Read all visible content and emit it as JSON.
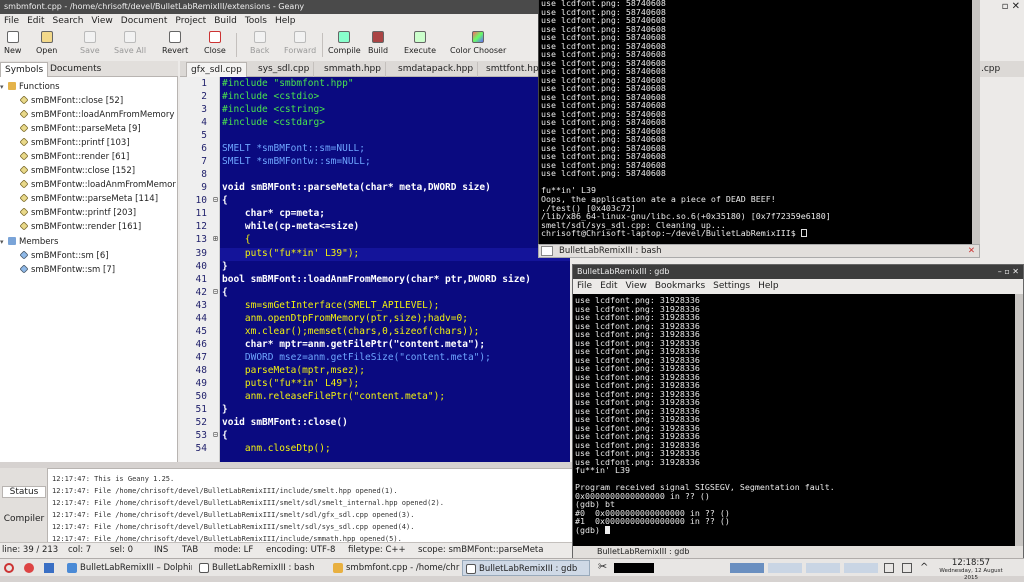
{
  "geany": {
    "title": "smbmfont.cpp - /home/chrisoft/devel/BulletLabRemixIII/extensions - Geany",
    "menu": [
      "File",
      "Edit",
      "Search",
      "View",
      "Document",
      "Project",
      "Build",
      "Tools",
      "Help"
    ],
    "toolbar": {
      "new": "New",
      "open": "Open",
      "save": "Save",
      "save_all": "Save All",
      "revert": "Revert",
      "close": "Close",
      "back": "Back",
      "forward": "Forward",
      "compile": "Compile",
      "build": "Build",
      "execute": "Execute",
      "color_chooser": "Color Chooser"
    },
    "sidebar": {
      "tabs": [
        "Symbols",
        "Documents"
      ],
      "functions_label": "Functions",
      "functions": [
        "smBMFont::close [52]",
        "smBMFont::loadAnmFromMemory",
        "smBMFont::parseMeta [9]",
        "smBMFont::printf [103]",
        "smBMFont::render [61]",
        "smBMFontw::close [152]",
        "smBMFontw::loadAnmFromMemor",
        "smBMFontw::parseMeta [114]",
        "smBMFontw::printf [203]",
        "smBMFontw::render [161]"
      ],
      "members_label": "Members",
      "members": [
        "smBMFont::sm [6]",
        "smBMFontw::sm [7]"
      ]
    },
    "editor": {
      "tabs": [
        "gfx_sdl.cpp",
        "sys_sdl.cpp",
        "smmath.hpp",
        "smdatapack.hpp",
        "smttfont.hpp"
      ],
      "tabs_right": ".cpp",
      "lines": [
        {
          "n": "1",
          "t": "#include \"smbmfont.hpp\""
        },
        {
          "n": "2",
          "t": "#include <cstdio>"
        },
        {
          "n": "3",
          "t": "#include <cstring>"
        },
        {
          "n": "4",
          "t": "#include <cstdarg>"
        },
        {
          "n": "5",
          "t": ""
        },
        {
          "n": "6",
          "t": "SMELT *smBMFont::sm=NULL;"
        },
        {
          "n": "7",
          "t": "SMELT *smBMFontw::sm=NULL;"
        },
        {
          "n": "8",
          "t": ""
        },
        {
          "n": "9",
          "t": "void smBMFont::parseMeta(char* meta,DWORD size)"
        },
        {
          "n": "10",
          "t": "{"
        },
        {
          "n": "11",
          "t": "    char* cp=meta;"
        },
        {
          "n": "12",
          "t": "    while(cp-meta<=size)"
        },
        {
          "n": "13",
          "t": "    {"
        },
        {
          "n": "39",
          "t": "    puts(\"fu**in' L39\");"
        },
        {
          "n": "40",
          "t": "}"
        },
        {
          "n": "41",
          "t": "bool smBMFont::loadAnmFromMemory(char* ptr,DWORD size)"
        },
        {
          "n": "42",
          "t": "{"
        },
        {
          "n": "43",
          "t": "    sm=smGetInterface(SMELT_APILEVEL);"
        },
        {
          "n": "44",
          "t": "    anm.openDtpFromMemory(ptr,size);hadv=0;"
        },
        {
          "n": "45",
          "t": "    xm.clear();memset(chars,0,sizeof(chars));"
        },
        {
          "n": "46",
          "t": "    char* mptr=anm.getFilePtr(\"content.meta\");"
        },
        {
          "n": "47",
          "t": "    DWORD msez=anm.getFileSize(\"content.meta\");"
        },
        {
          "n": "48",
          "t": "    parseMeta(mptr,msez);"
        },
        {
          "n": "49",
          "t": "    puts(\"fu**in' L49\");"
        },
        {
          "n": "50",
          "t": "    anm.releaseFilePtr(\"content.meta\");"
        },
        {
          "n": "51",
          "t": "}"
        },
        {
          "n": "52",
          "t": "void smBMFont::close()"
        },
        {
          "n": "53",
          "t": "{"
        },
        {
          "n": "54",
          "t": "    anm.closeDtp();"
        }
      ]
    },
    "messages": {
      "tabs": [
        "Status",
        "Compiler"
      ],
      "lines": [
        "12:17:47: This is Geany 1.25.",
        "12:17:47: File /home/chrisoft/devel/BulletLabRemixIII/include/smelt.hpp opened(1).",
        "12:17:47: File /home/chrisoft/devel/BulletLabRemixIII/smelt/sdl/smelt_internal.hpp opened(2).",
        "12:17:47: File /home/chrisoft/devel/BulletLabRemixIII/smelt/sdl/gfx_sdl.cpp opened(3).",
        "12:17:47: File /home/chrisoft/devel/BulletLabRemixIII/smelt/sdl/sys_sdl.cpp opened(4).",
        "12:17:47: File /home/chrisoft/devel/BulletLabRemixIII/include/smmath.hpp opened(5)."
      ]
    },
    "status": {
      "line": "line: 39 / 213",
      "col": "col: 7",
      "sel": "sel: 0",
      "ins": "INS",
      "tab": "TAB",
      "mode": "mode: LF",
      "encoding": "encoding: UTF-8",
      "filetype": "filetype: C++",
      "scope": "scope: smBMFont::parseMeta"
    }
  },
  "terminal1": {
    "lines": [
      "use lcdfont.png: 58740608",
      "use lcdfont.png: 58740608",
      "use lcdfont.png: 58740608",
      "use lcdfont.png: 58740608",
      "use lcdfont.png: 58740608",
      "use lcdfont.png: 58740608",
      "use lcdfont.png: 58740608",
      "use lcdfont.png: 58740608",
      "use lcdfont.png: 58740608",
      "use lcdfont.png: 58740608",
      "use lcdfont.png: 58740608",
      "use lcdfont.png: 58740608",
      "use lcdfont.png: 58740608",
      "use lcdfont.png: 58740608",
      "use lcdfont.png: 58740608",
      "use lcdfont.png: 58740608",
      "use lcdfont.png: 58740608",
      "use lcdfont.png: 58740608",
      "use lcdfont.png: 58740608",
      "use lcdfont.png: 58740608",
      "use lcdfont.png: 58740608",
      "fu**in' L39",
      "Oops, the application ate a piece of DEAD BEEF!",
      "./test() [0x403c72]",
      "/lib/x86_64-linux-gnu/libc.so.6(+0x35180) [0x7f72359e6180]",
      "smelt/sdl/sys_sdl.cpp: Cleaning up...",
      "chrisoft@Chrisoft-laptop:~/devel/BulletLabRemixIII$ "
    ],
    "bottom_label": "BulletLabRemixIII : bash"
  },
  "gdb": {
    "title": "BulletLabRemixIII : gdb",
    "menu": [
      "File",
      "Edit",
      "View",
      "Bookmarks",
      "Settings",
      "Help"
    ],
    "lines": [
      "use lcdfont.png: 31928336",
      "use lcdfont.png: 31928336",
      "use lcdfont.png: 31928336",
      "use lcdfont.png: 31928336",
      "use lcdfont.png: 31928336",
      "use lcdfont.png: 31928336",
      "use lcdfont.png: 31928336",
      "use lcdfont.png: 31928336",
      "use lcdfont.png: 31928336",
      "use lcdfont.png: 31928336",
      "use lcdfont.png: 31928336",
      "use lcdfont.png: 31928336",
      "use lcdfont.png: 31928336",
      "use lcdfont.png: 31928336",
      "use lcdfont.png: 31928336",
      "use lcdfont.png: 31928336",
      "use lcdfont.png: 31928336",
      "use lcdfont.png: 31928336",
      "use lcdfont.png: 31928336",
      "use lcdfont.png: 31928336",
      "fu**in' L39",
      "",
      "Program received signal SIGSEGV, Segmentation fault.",
      "0x0000000000000000 in ?? ()",
      "(gdb) bt",
      "#0  0x0000000000000000 in ?? ()",
      "#1  0x0000000000000000 in ?? ()",
      "(gdb) "
    ],
    "bottom_label": "BulletLabRemixIII : gdb"
  },
  "taskbar": {
    "tasks": [
      "BulletLabRemixIII – Dolphin",
      "BulletLabRemixIII : bash",
      "smbmfont.cpp - /home/chris",
      "BulletLabRemixIII : gdb"
    ],
    "time": "12:18:57",
    "date": "Wednesday, 12 August 2015"
  }
}
